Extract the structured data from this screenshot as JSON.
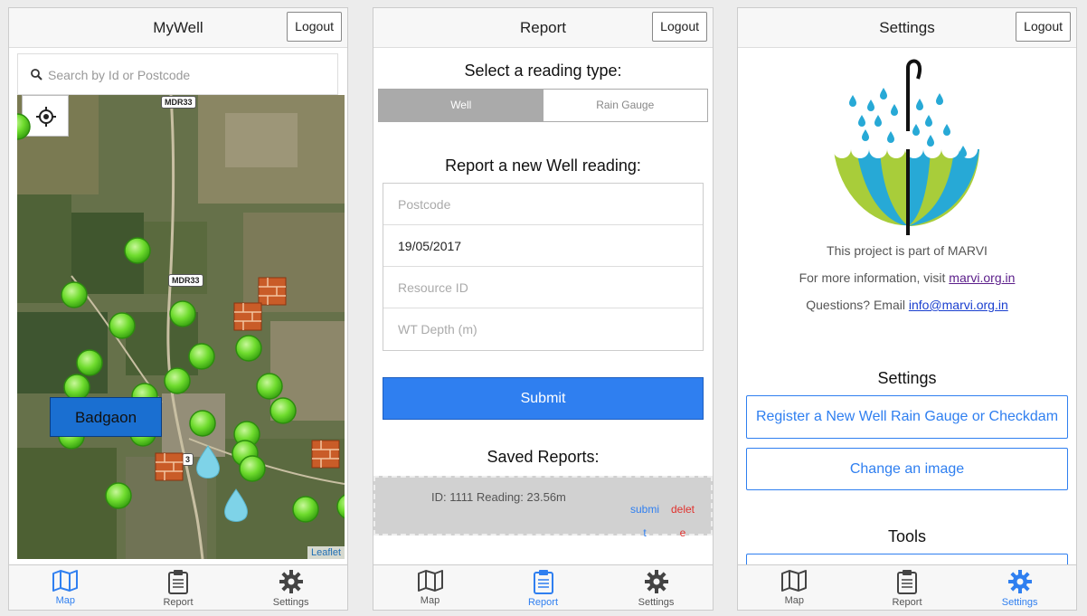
{
  "map_screen": {
    "title": "MyWell",
    "logout_label": "Logout",
    "search_placeholder": "Search by Id or Postcode",
    "town_label": "Badgaon",
    "road_labels": [
      "MDR33",
      "MDR33",
      "3"
    ],
    "attribution": "Leaflet",
    "tabs": [
      {
        "label": "Map",
        "icon": "map-icon",
        "active": true
      },
      {
        "label": "Report",
        "icon": "clipboard-icon",
        "active": false
      },
      {
        "label": "Settings",
        "icon": "gear-icon",
        "active": false
      }
    ]
  },
  "report_screen": {
    "title": "Report",
    "logout_label": "Logout",
    "select_heading": "Select a reading type:",
    "reading_types": [
      "Well",
      "Rain Gauge"
    ],
    "selected_type": "Well",
    "form_heading": "Report a new Well reading:",
    "fields": [
      {
        "placeholder": "Postcode",
        "value": ""
      },
      {
        "placeholder": "",
        "value": "19/05/2017"
      },
      {
        "placeholder": "Resource ID",
        "value": ""
      },
      {
        "placeholder": "WT Depth (m)",
        "value": ""
      }
    ],
    "submit_label": "Submit",
    "saved_heading": "Saved Reports:",
    "saved_reports": [
      {
        "text": "ID: 1111 Reading: 23.56m",
        "submit_label": "submit",
        "delete_label": "delete"
      }
    ],
    "tabs": [
      {
        "label": "Map",
        "icon": "map-icon",
        "active": false
      },
      {
        "label": "Report",
        "icon": "clipboard-icon",
        "active": true
      },
      {
        "label": "Settings",
        "icon": "gear-icon",
        "active": false
      }
    ]
  },
  "settings_screen": {
    "title": "Settings",
    "logout_label": "Logout",
    "project_text": "This project is part of MARVI",
    "info_prefix": "For more information, visit ",
    "info_link": "marvi.org.in",
    "questions_prefix": "Questions? Email ",
    "email_link": "info@marvi.org.in",
    "settings_heading": "Settings",
    "register_label": "Register a New Well Rain Gauge or Checkdam",
    "change_image_label": "Change an image",
    "tools_heading": "Tools",
    "tabs": [
      {
        "label": "Map",
        "icon": "map-icon",
        "active": false
      },
      {
        "label": "Report",
        "icon": "clipboard-icon",
        "active": false
      },
      {
        "label": "Settings",
        "icon": "gear-icon",
        "active": true
      }
    ]
  },
  "colors": {
    "accent": "#2f7ff0",
    "delete": "#e0322e",
    "well_marker": "#6fdc2e",
    "town_label_bg": "#1a6fd1"
  }
}
